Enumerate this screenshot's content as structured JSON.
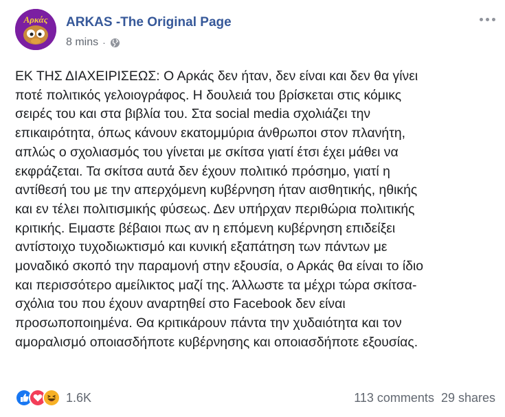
{
  "header": {
    "page_name": "ARKAS -The Original Page",
    "timestamp": "8 mins",
    "separator": "·",
    "privacy_icon": "globe-icon",
    "avatar_text": "Αρκάς"
  },
  "post": {
    "text": "ΕΚ ΤΗΣ ΔΙΑΧΕΙΡΙΣΕΩΣ: Ο Αρκάς δεν ήταν, δεν είναι και δεν θα γίνει\nποτέ πολιτικός γελοιογράφος. Η δουλειά του βρίσκεται στις κόμικς\nσειρές του και στα βιβλία του. Στα social media σχολιάζει την\nεπικαιρότητα, όπως κάνουν εκατομμύρια άνθρωποι στον πλανήτη,\nαπλώς ο σχολιασμός του γίνεται με σκίτσα γιατί έτσι έχει μάθει να\nεκφράζεται. Τα σκίτσα αυτά δεν έχουν πολιτικό πρόσημο, γιατί η\nαντίθεσή του με την απερχόμενη κυβέρνηση ήταν αισθητικής, ηθικής\nκαι εν τέλει πολιτισμικής φύσεως. Δεν υπήρχαν περιθώρια πολιτικής\nκριτικής. Ειμαστε βέβαιοι πως αν η επόμενη κυβέρνηση επιδείξει\nαντίστοιχο τυχοδιωκτισμό και κυνική εξαπάτηση των πάντων με\nμοναδικό σκοπό την παραμονή στην εξουσία, ο Αρκάς θα είναι το ίδιο\nκαι περισσότερο αμείλικτος μαζί της. Άλλωστε τα μέχρι τώρα σκίτσα-\nσχόλια του που έχουν αναρτηθεί στο Facebook δεν είναι\nπροσωποποιημένα. Θα κριτικάρουν πάντα την χυδαιότητα και τον\nαμοραλισμό οποιασδήποτε κυβέρνησης και οποιασδήποτε εξουσίας."
  },
  "footer": {
    "reaction_icons": [
      "like-icon",
      "love-icon",
      "haha-icon"
    ],
    "reaction_count": "1.6K",
    "comments": "113 comments",
    "shares": "29 shares"
  },
  "colors": {
    "link": "#365899",
    "meta": "#616770",
    "like": "#1877f2",
    "love": "#f33e58",
    "haha": "#f7b125",
    "avatar_bg": "#7b1fa2"
  }
}
